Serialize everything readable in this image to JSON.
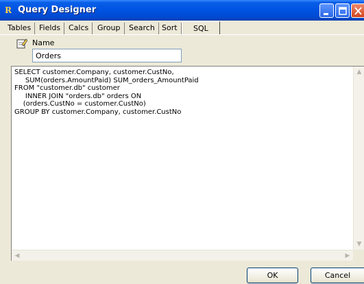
{
  "window": {
    "title": "Query Designer",
    "app_icon_glyph": "R"
  },
  "tabs": [
    {
      "label": "Tables"
    },
    {
      "label": "Fields"
    },
    {
      "label": "Calcs"
    },
    {
      "label": "Group"
    },
    {
      "label": "Search"
    },
    {
      "label": "Sort"
    },
    {
      "label": "SQL",
      "selected": true
    }
  ],
  "name_field": {
    "label": "Name",
    "value": "Orders",
    "icon": "notepad-pencil-icon"
  },
  "sql": {
    "text": "SELECT customer.Company, customer.CustNo,\n     SUM(orders.AmountPaid) SUM_orders_AmountPaid\nFROM \"customer.db\" customer\n     INNER JOIN \"orders.db\" orders ON\n    (orders.CustNo = customer.CustNo)\nGROUP BY customer.Company, customer.CustNo"
  },
  "buttons": {
    "ok_label": "OK",
    "cancel_label": "Cancel"
  },
  "colors": {
    "titlebar": "#0054e3",
    "dialog_bg": "#ece9d8",
    "close_button": "#d2441e"
  }
}
